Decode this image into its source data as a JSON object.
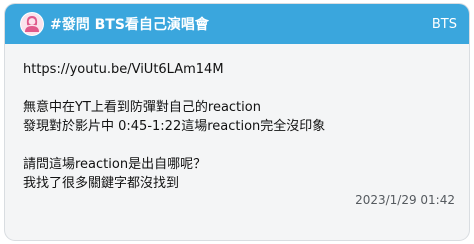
{
  "header": {
    "title": "#發問 BTS看自己演唱會",
    "board": "BTS",
    "colors": {
      "bar": "#3aa6dd",
      "avatar_icon": "#e0598b"
    },
    "avatar_icon": "female-user-icon"
  },
  "post": {
    "lines": [
      "https://youtu.be/ViUt6LAm14M",
      "",
      "無意中在YT上看到防彈對自己的reaction",
      "發現對於影片中 0:45-1:22這場reaction完全沒印象",
      "",
      "請問這場reaction是出自哪呢？",
      "我找了很多關鍵字都沒找到"
    ],
    "timestamp": "2023/1/29 01:42"
  }
}
